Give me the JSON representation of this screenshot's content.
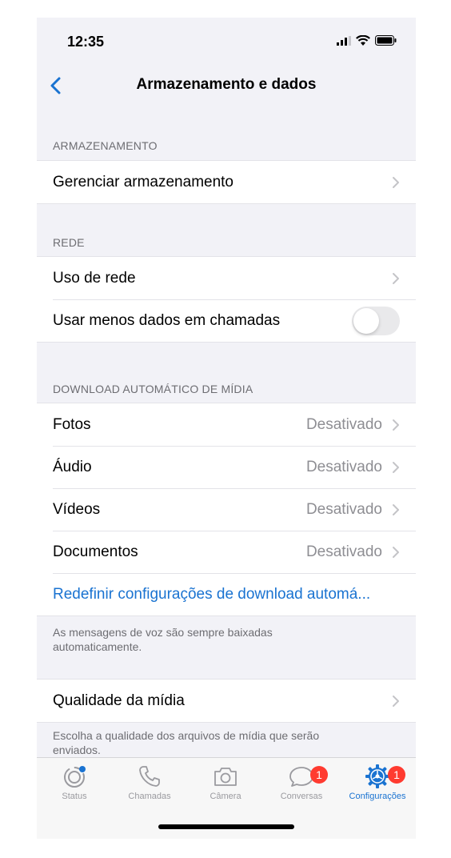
{
  "status_bar": {
    "time": "12:35"
  },
  "nav": {
    "title": "Armazenamento e dados"
  },
  "sections": {
    "storage": {
      "header": "ARMAZENAMENTO",
      "manage_label": "Gerenciar armazenamento"
    },
    "network": {
      "header": "REDE",
      "usage_label": "Uso de rede",
      "low_data_label": "Usar menos dados em chamadas",
      "low_data_enabled": false
    },
    "auto_download": {
      "header": "DOWNLOAD AUTOMÁTICO DE MÍDIA",
      "items": [
        {
          "label": "Fotos",
          "value": "Desativado"
        },
        {
          "label": "Áudio",
          "value": "Desativado"
        },
        {
          "label": "Vídeos",
          "value": "Desativado"
        },
        {
          "label": "Documentos",
          "value": "Desativado"
        }
      ],
      "reset_label": "Redefinir configurações de download automá...",
      "footer": "As mensagens de voz são sempre baixadas automaticamente."
    },
    "media_quality": {
      "label": "Qualidade da mídia",
      "footer": "Escolha a qualidade dos arquivos de mídia que serão enviados."
    }
  },
  "tab_bar": {
    "tabs": [
      {
        "label": "Status",
        "icon": "status-icon"
      },
      {
        "label": "Chamadas",
        "icon": "phone-icon"
      },
      {
        "label": "Câmera",
        "icon": "camera-icon"
      },
      {
        "label": "Conversas",
        "icon": "chat-bubble-icon",
        "badge": "1"
      },
      {
        "label": "Configurações",
        "icon": "gear-icon",
        "badge": "1",
        "active": true
      }
    ]
  },
  "colors": {
    "accent": "#1a73d1",
    "badge": "#ff3b30",
    "background": "#f2f2f7"
  }
}
